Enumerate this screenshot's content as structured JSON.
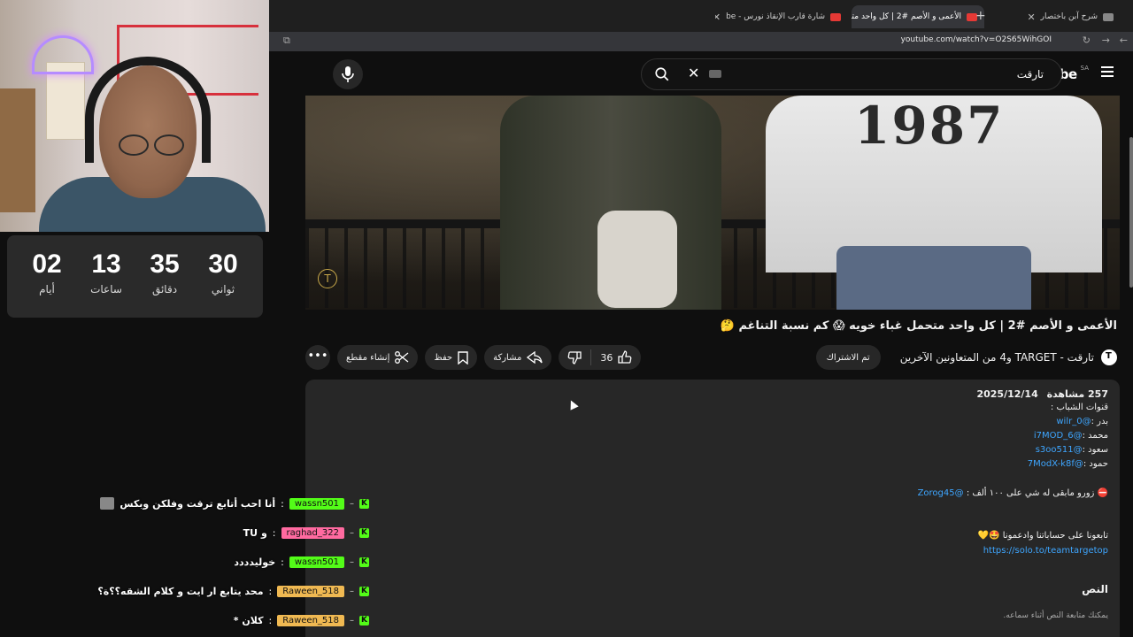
{
  "browser": {
    "tabs": [
      {
        "title": "شرح آبن باختصار",
        "active": false
      },
      {
        "title": "الأعمى و الأصم #2 | كل واحد متـ",
        "active": true
      },
      {
        "title": "شارة قارب الإنقاذ نورس - be",
        "active": false
      }
    ],
    "url": "youtube.com/watch?v=O2S65WihGOI"
  },
  "youtube": {
    "logo_text": "YouTube",
    "country": "SA",
    "search_query": "تارقت"
  },
  "video": {
    "jersey_text": "1987",
    "watermark": "T",
    "title": "الأعمى و الأصم #2 | كل واحد متحمل غباء خويه 😱 كم نسبة التناغم 🤔",
    "channel": "تارقت - TARGET و4 من المتعاونين الآخرين",
    "subscribe_label": "تم الاشتراك",
    "like_count": "36",
    "share_label": "مشاركة",
    "save_label": "حفظ",
    "clip_label": "إنشاء مقطع",
    "more_label": "•••"
  },
  "description": {
    "views": "257 مشاهدة",
    "date": "2025/12/14",
    "lines": [
      {
        "prefix": "قنوات الشباب :",
        "link": ""
      },
      {
        "prefix": "بدر :",
        "link": "@wilr_0"
      },
      {
        "prefix": "محمد :",
        "link": "@i7MOD_6"
      },
      {
        "prefix": "سعود :",
        "link": "@s3oo511"
      },
      {
        "prefix": "حمود :",
        "link": "@7ModX-k8f"
      }
    ],
    "zorog_line": "⛔ زورو مابقى له شي على ١٠٠ ألف :",
    "zorog_link": "@Zorog45",
    "follow_line": "تابعونا على حساباتنا وادعمونا 🤩💛",
    "follow_link": "https://solo.to/teamtargetop",
    "transcript_title": "النص",
    "transcript_sub": "يمكنك متابعة النص أثناء سماعه."
  },
  "countdown": [
    {
      "value": "02",
      "label": "أيام"
    },
    {
      "value": "13",
      "label": "ساعات"
    },
    {
      "value": "35",
      "label": "دقائق"
    },
    {
      "value": "30",
      "label": "ثواني"
    }
  ],
  "chat": [
    {
      "user": "wassn501",
      "color": "#53fc18",
      "text": "أنا احب أتابع ترقت وفلكن وبكس",
      "emote": true
    },
    {
      "user": "raghad_322",
      "color": "#ff6aa0",
      "text": "و TU",
      "emote": false
    },
    {
      "user": "wassn501",
      "color": "#53fc18",
      "text": "خوليدددد",
      "emote": false
    },
    {
      "user": "Raween_518",
      "color": "#f0b952",
      "text": "محد يتابع ار ايت و كلام الشقه؟؟ة؟",
      "emote": false
    },
    {
      "user": "Raween_518",
      "color": "#f0b952",
      "text": "كلان *",
      "emote": false
    }
  ]
}
